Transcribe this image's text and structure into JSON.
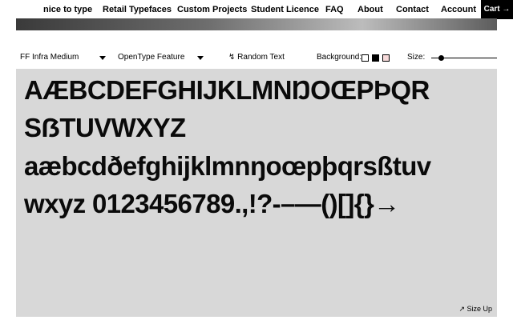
{
  "nav": {
    "items": [
      "nice to type",
      "Retail Typefaces",
      "Custom Projects",
      "Student Licence",
      "FAQ",
      "About",
      "Contact",
      "Account"
    ],
    "cart": "Cart →"
  },
  "toolbar": {
    "font_select": "FF Infra Medium",
    "feature_select": "OpenType Feature",
    "random_text": "↯ Random Text",
    "background_label": "Background:",
    "swatch_colors": [
      "#ffffff",
      "#000000",
      "#f7dada"
    ],
    "size_label": "Size:"
  },
  "specimen": {
    "lines": [
      "AÆBCDEFGHIJKLMNŊOŒPÞQR",
      "SẞTUVWXYZ",
      "aæbcdðefghijklmnŋoœpþqrsßtuv",
      "wxyz 0123456789.,!?-–—()[]{}→"
    ],
    "size_up": "↗ Size Up"
  },
  "colors": {
    "specimen_bg": "#d8d8d8",
    "accent": "#000000"
  }
}
